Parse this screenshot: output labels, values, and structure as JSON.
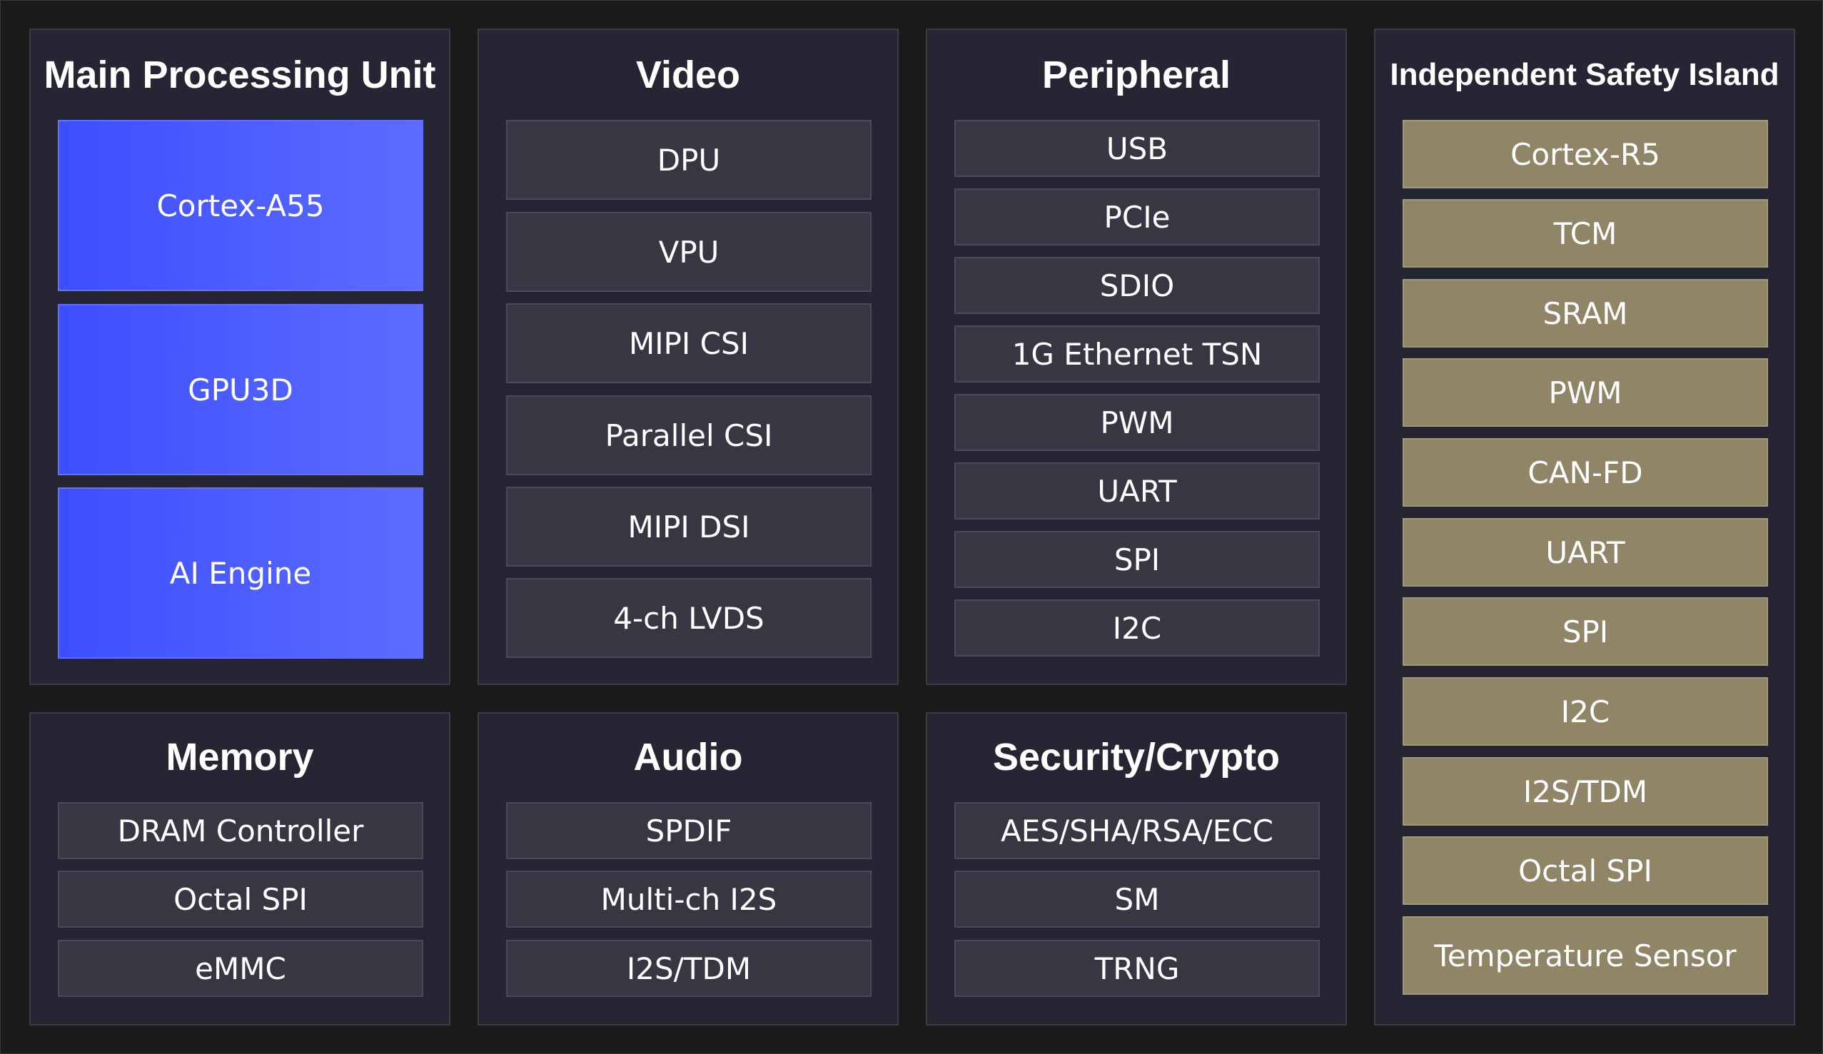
{
  "colors": {
    "background": "#1a1a1a",
    "panel": "#252533",
    "panel_border": "#3b3b48",
    "item_dark": "#373744",
    "item_blue_start": "#3d4eff",
    "item_blue_end": "#5c6cff",
    "item_gold": "#908567",
    "text": "#ffffff"
  },
  "panels": {
    "main": {
      "title": "Main Processing Unit",
      "items": [
        "Cortex-A55",
        "GPU3D",
        "AI Engine"
      ]
    },
    "video": {
      "title": "Video",
      "items": [
        "DPU",
        "VPU",
        "MIPI CSI",
        "Parallel CSI",
        "MIPI DSI",
        "4-ch LVDS"
      ]
    },
    "peripheral": {
      "title": "Peripheral",
      "items": [
        "USB",
        "PCIe",
        "SDIO",
        "1G Ethernet TSN",
        "PWM",
        "UART",
        "SPI",
        "I2C"
      ]
    },
    "safety": {
      "title": "Independent Safety Island",
      "items": [
        "Cortex-R5",
        "TCM",
        "SRAM",
        "PWM",
        "CAN-FD",
        "UART",
        "SPI",
        "I2C",
        "I2S/TDM",
        "Octal SPI",
        "Temperature Sensor"
      ]
    },
    "memory": {
      "title": "Memory",
      "items": [
        "DRAM Controller",
        "Octal SPI",
        "eMMC"
      ]
    },
    "audio": {
      "title": "Audio",
      "items": [
        "SPDIF",
        "Multi-ch I2S",
        "I2S/TDM"
      ]
    },
    "security": {
      "title": "Security/Crypto",
      "items": [
        "AES/SHA/RSA/ECC",
        "SM",
        "TRNG"
      ]
    }
  }
}
